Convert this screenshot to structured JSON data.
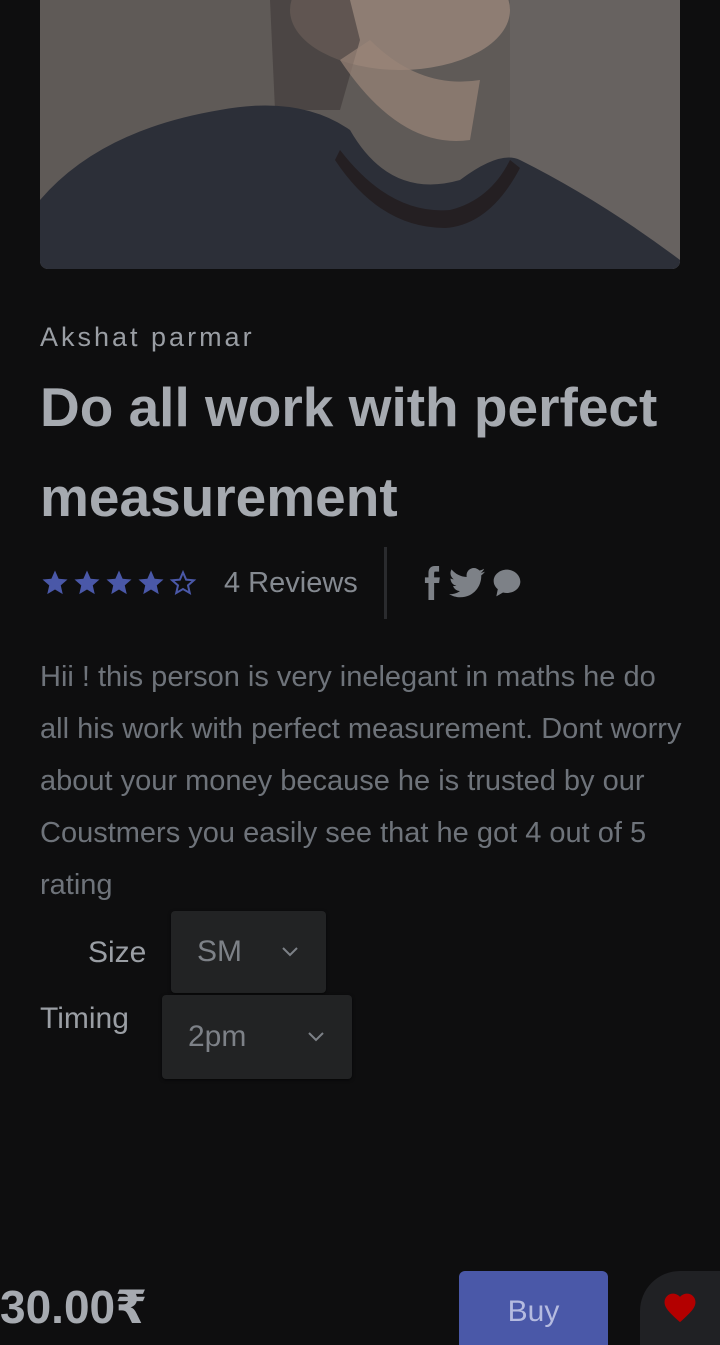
{
  "product": {
    "seller": "Akshat parmar",
    "title": "Do all work with perfect measurement",
    "rating": 4,
    "rating_max": 5,
    "reviews_label": "4 Reviews",
    "description": "Hii ! this person is very inelegant in maths he do all his work with perfect measurement. Dont worry about your money because he is trusted by our Coustmers you easily see that he got 4 out of 5 rating"
  },
  "options": {
    "size_label": "Size",
    "size_value": "SM",
    "timing_label": "Timing",
    "timing_value": "2pm"
  },
  "purchase": {
    "price": "30.00₹",
    "buy_label": "Buy"
  },
  "colors": {
    "star": "#4a58a8",
    "buy": "#4a58a8",
    "heart": "#b30000",
    "background": "#0e0e0f"
  },
  "icons": [
    "star-icon",
    "facebook-icon",
    "twitter-icon",
    "chat-icon",
    "chevron-down-icon",
    "heart-icon"
  ]
}
